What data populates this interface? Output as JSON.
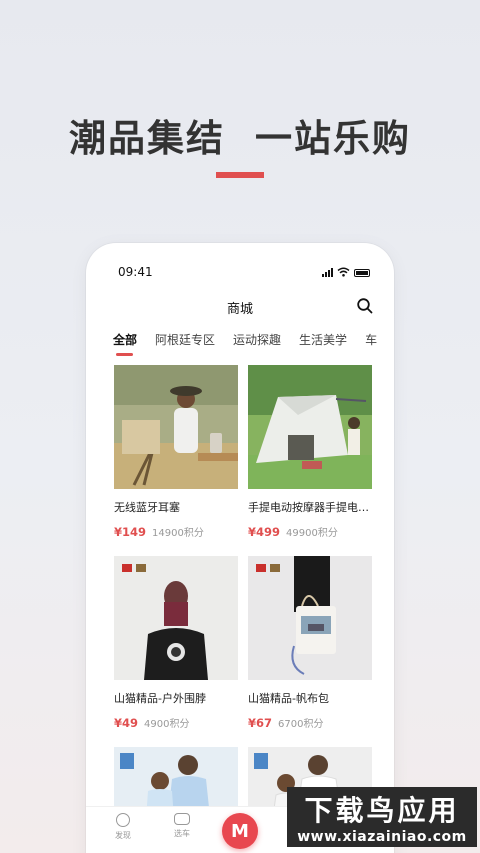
{
  "headline": {
    "left": "潮品集结",
    "right": "一站乐购"
  },
  "status_bar": {
    "time": "09:41"
  },
  "header": {
    "title": "商城"
  },
  "tabs": [
    "全部",
    "阿根廷专区",
    "运动探趣",
    "生活美学",
    "车"
  ],
  "products": [
    {
      "name": "无线蓝牙耳塞",
      "price": "¥149",
      "points": "14900积分"
    },
    {
      "name": "手提电动按摩器手提电动按摩器",
      "price": "¥499",
      "points": "49900积分"
    },
    {
      "name": "山猫精品-户外围脖",
      "price": "¥49",
      "points": "4900积分"
    },
    {
      "name": "山猫精品-帆布包",
      "price": "¥67",
      "points": "6700积分"
    },
    {
      "name": "",
      "price": "",
      "points": ""
    },
    {
      "name": "",
      "price": "",
      "points": ""
    }
  ],
  "bottom_nav": {
    "discover": "发现",
    "select_car": "选车",
    "center": "M"
  },
  "watermark": {
    "title": "下载鸟应用",
    "url": "www.xiazainiao.com"
  },
  "colors": {
    "accent": "#e04f4f",
    "headline": "#333333"
  }
}
